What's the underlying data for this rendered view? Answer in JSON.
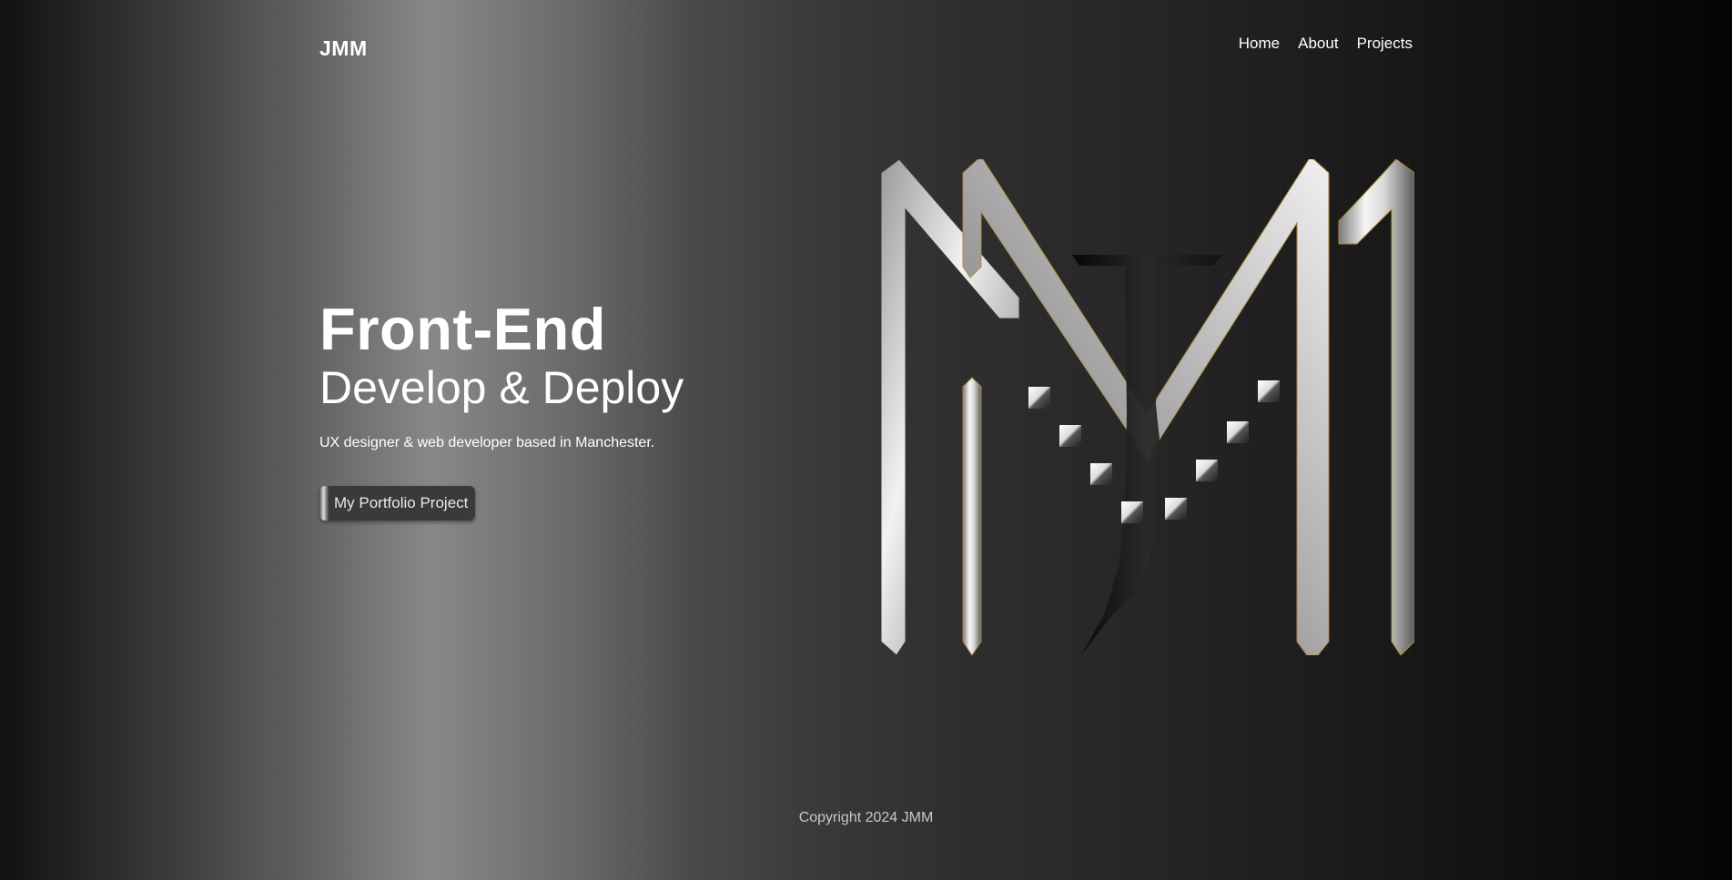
{
  "header": {
    "brand": "JMM",
    "nav": [
      "Home",
      "About",
      "Projects"
    ]
  },
  "hero": {
    "title": "Front-End",
    "subtitle": "Develop & Deploy",
    "description": "UX designer & web developer based in Manchester.",
    "cta_label": "My Portfolio Project"
  },
  "logo": {
    "icon": "jmm-monogram-logo",
    "colors": {
      "metal_light": "#f4f4f4",
      "metal_dark": "#6e6e6e",
      "outline_gold": "#b08a3c",
      "j_dark": "#0f0f0f"
    }
  },
  "footer": {
    "copyright": "Copyright 2024 JMM"
  }
}
